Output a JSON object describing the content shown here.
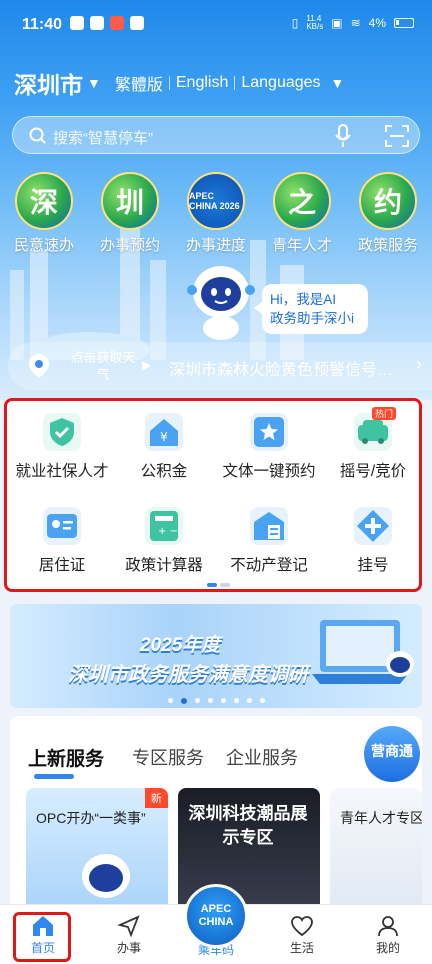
{
  "status": {
    "time": "11:40",
    "network": "11.4\nKB/s",
    "battery": "4%"
  },
  "header": {
    "city": "深圳市",
    "langs": [
      "繁體版",
      "English",
      "Languages"
    ]
  },
  "search": {
    "placeholder": "搜索“智慧停车”"
  },
  "featured": [
    {
      "char": "深",
      "label": "民意速办"
    },
    {
      "char": "圳",
      "label": "办事预约"
    },
    {
      "char": "APEC CHINA 2026",
      "label": "办事进度"
    },
    {
      "char": "之",
      "label": "青年人才"
    },
    {
      "char": "约",
      "label": "政策服务"
    }
  ],
  "assistant": {
    "line1": "Hi，我是AI",
    "line2": "政务助手深小i"
  },
  "weather": {
    "label": "点击获取天气",
    "alert": "深圳市森林火险黄色预警信号…"
  },
  "services": [
    {
      "label": "就业社保人才",
      "icon": "shield-check-icon",
      "color": "#3fc3a0"
    },
    {
      "label": "公积金",
      "icon": "house-yuan-icon",
      "color": "#4aa3f2"
    },
    {
      "label": "文体一键预约",
      "icon": "star-ticket-icon",
      "color": "#4aa3f2"
    },
    {
      "label": "摇号/竞价",
      "icon": "car-icon",
      "color": "#3fc3a0",
      "badge": "热门"
    },
    {
      "label": "居住证",
      "icon": "id-card-icon",
      "color": "#4aa3f2"
    },
    {
      "label": "政策计算器",
      "icon": "calculator-icon",
      "color": "#3fc3a0"
    },
    {
      "label": "不动产登记",
      "icon": "building-doc-icon",
      "color": "#4aa3f2"
    },
    {
      "label": "挂号",
      "icon": "plus-diamond-icon",
      "color": "#4aa3f2"
    }
  ],
  "banner": {
    "line1": "2025年度",
    "line2": "深圳市政务服务满意度调研"
  },
  "tabs": [
    "上新服务",
    "专区服务",
    "企业服务"
  ],
  "biz_button": "营商通",
  "promos": [
    {
      "title": "OPC开办“一类事”",
      "badge": "新"
    },
    {
      "title": "深圳科技潮品展示专区"
    },
    {
      "title": "青年人才专区"
    }
  ],
  "nav": [
    {
      "label": "首页",
      "icon": "home-icon"
    },
    {
      "label": "办事",
      "icon": "send-icon"
    },
    {
      "label": "乘车码",
      "icon": "apec-icon"
    },
    {
      "label": "生活",
      "icon": "heart-icon"
    },
    {
      "label": "我的",
      "icon": "user-icon"
    }
  ],
  "apec_nav": {
    "line1": "APEC",
    "line2": "CHINA"
  }
}
